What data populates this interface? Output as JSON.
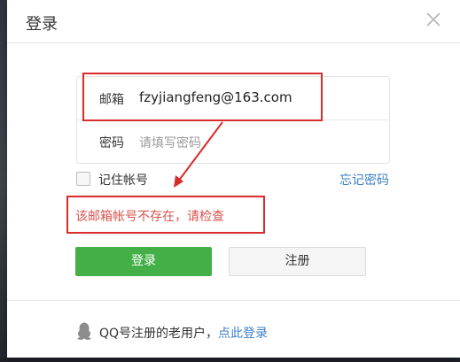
{
  "dialog": {
    "title": "登录",
    "close_icon": "close-icon"
  },
  "form": {
    "email_label": "邮箱",
    "email_value": "fzyjiangfeng@163.com",
    "password_label": "密码",
    "password_placeholder": "请填写密码"
  },
  "options": {
    "remember_label": "记住帐号",
    "remember_checked": false,
    "forgot_link": "忘记密码"
  },
  "error": {
    "message": "该邮箱帐号不存在，请检查"
  },
  "buttons": {
    "login": "登录",
    "register": "注册"
  },
  "footer": {
    "icon": "qq-penguin-icon",
    "text": "QQ号注册的老用户，",
    "link": "点此登录"
  },
  "colors": {
    "primary_green": "#43b047",
    "link_blue": "#3b7fc4",
    "error_red": "#d9534f",
    "annotation_red": "#d92b2b"
  }
}
